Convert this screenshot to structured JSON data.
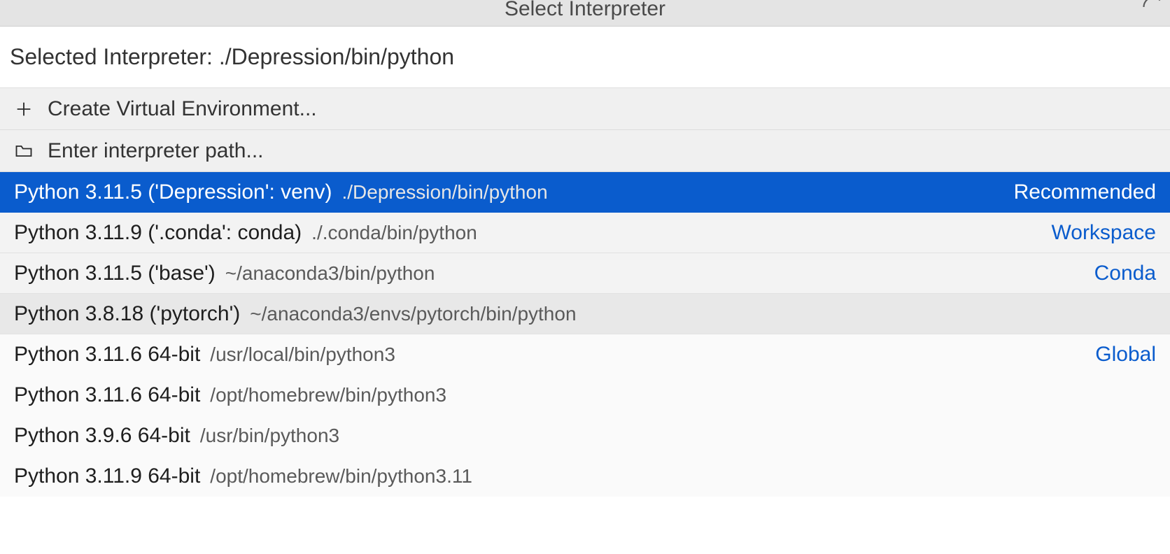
{
  "header": {
    "title": "Select Interpreter"
  },
  "input": {
    "value": "Selected Interpreter: ./Depression/bin/python"
  },
  "actions": {
    "create_venv": "Create Virtual Environment...",
    "enter_path": "Enter interpreter path..."
  },
  "interpreters": [
    {
      "name": "Python 3.11.5 ('Depression': venv)",
      "path": "./Depression/bin/python",
      "badge": "Recommended",
      "selected": true
    },
    {
      "name": "Python 3.11.9 ('.conda': conda)",
      "path": "./.conda/bin/python",
      "badge": "Workspace",
      "selected": false
    },
    {
      "name": "Python 3.11.5 ('base')",
      "path": "~/anaconda3/bin/python",
      "badge": "Conda",
      "selected": false
    },
    {
      "name": "Python 3.8.18 ('pytorch')",
      "path": "~/anaconda3/envs/pytorch/bin/python",
      "badge": "",
      "selected": false
    },
    {
      "name": "Python 3.11.6 64-bit",
      "path": "/usr/local/bin/python3",
      "badge": "Global",
      "selected": false
    },
    {
      "name": "Python 3.11.6 64-bit",
      "path": "/opt/homebrew/bin/python3",
      "badge": "",
      "selected": false
    },
    {
      "name": "Python 3.9.6 64-bit",
      "path": "/usr/bin/python3",
      "badge": "",
      "selected": false
    },
    {
      "name": "Python 3.11.9 64-bit",
      "path": "/opt/homebrew/bin/python3.11",
      "badge": "",
      "selected": false
    }
  ]
}
